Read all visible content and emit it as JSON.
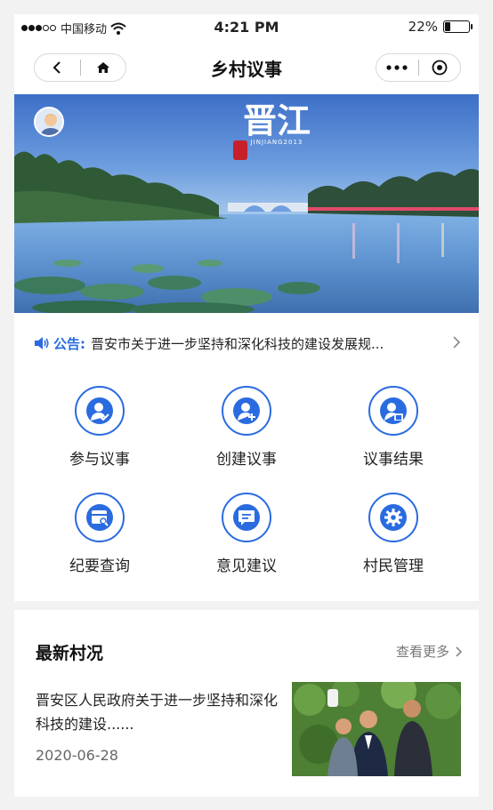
{
  "status_bar": {
    "carrier": "中国移动",
    "time": "4:21 PM",
    "battery": "22%",
    "battery_level": 0.22
  },
  "nav": {
    "title": "乡村议事"
  },
  "banner": {
    "calligraphy": "晋江",
    "caption": "JINJIANG2013"
  },
  "notice": {
    "label": "公告:",
    "text": "晋安市关于进一步坚持和深化科技的建设发展规..."
  },
  "menu": [
    {
      "label": "参与议事",
      "icon": "user-check-icon"
    },
    {
      "label": "创建议事",
      "icon": "user-add-icon"
    },
    {
      "label": "议事结果",
      "icon": "user-result-icon"
    },
    {
      "label": "纪要查询",
      "icon": "archive-search-icon"
    },
    {
      "label": "意见建议",
      "icon": "comment-icon"
    },
    {
      "label": "村民管理",
      "icon": "gear-icon"
    }
  ],
  "news": {
    "heading": "最新村况",
    "more": "查看更多",
    "title": "晋安区人民政府关于进一步坚持和深化科技的建设......",
    "date": "2020-06-28"
  },
  "colors": {
    "accent": "#2a6be0",
    "background": "#f2f2f2"
  }
}
